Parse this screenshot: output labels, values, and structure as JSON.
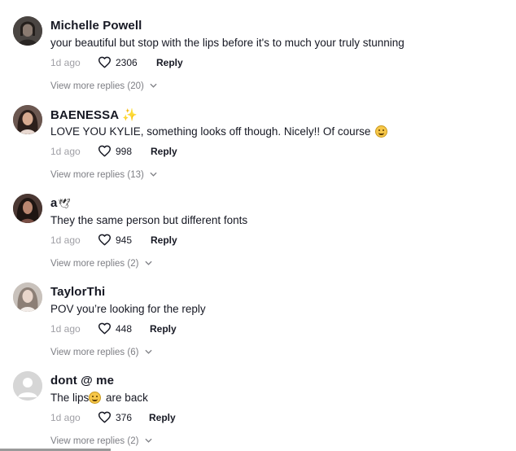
{
  "comments": [
    {
      "username": "Michelle Powell",
      "badge": "",
      "text": "your beautiful but stop with the lips before it's to much your truly stunning",
      "text_suffix": "",
      "time": "1d ago",
      "likes": "2306",
      "reply_label": "Reply",
      "view_replies": "View more replies (20)",
      "avatar_icon": "dark-portrait-avatar"
    },
    {
      "username": "BAENESSA",
      "badge": "✨",
      "text": "LOVE YOU KYLIE, something looks off though. Nicely!! Of course",
      "text_suffix": "",
      "time": "1d ago",
      "likes": "998",
      "reply_label": "Reply",
      "view_replies": "View more replies (13)",
      "avatar_icon": "woman-portrait-avatar"
    },
    {
      "username": "a",
      "badge": "🕊",
      "text": "They the same person but different fonts",
      "text_suffix": "",
      "time": "1d ago",
      "likes": "945",
      "reply_label": "Reply",
      "view_replies": "View more replies (2)",
      "avatar_icon": "woman-portrait-avatar"
    },
    {
      "username": "TaylorThi",
      "badge": "",
      "text": "POV you’re looking for the reply",
      "text_suffix": "",
      "time": "1d ago",
      "likes": "448",
      "reply_label": "Reply",
      "view_replies": "View more replies (6)",
      "avatar_icon": "light-portrait-avatar"
    },
    {
      "username": "dont @ me",
      "badge": "",
      "text": "The lips",
      "text_suffix": "are back",
      "time": "1d ago",
      "likes": "376",
      "reply_label": "Reply",
      "view_replies": "View more replies (2)",
      "avatar_icon": "default-user-avatar"
    }
  ],
  "icons": {
    "like": "heart-outline-icon",
    "chevron": "chevron-down-icon"
  },
  "colors": {
    "text": "#161823",
    "muted": "#a0a0a6",
    "replies": "#7d7e84"
  }
}
